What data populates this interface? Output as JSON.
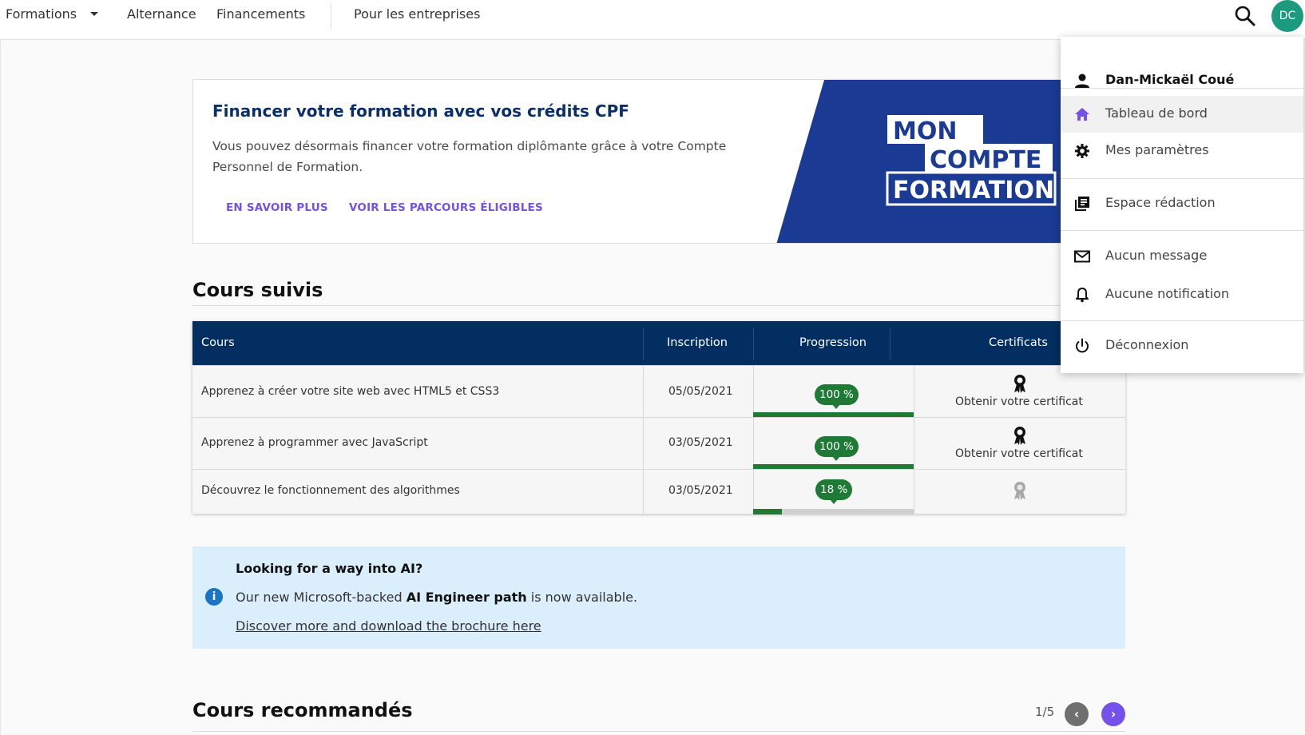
{
  "nav": {
    "items": [
      "Formations",
      "Alternance",
      "Financements",
      "Pour les entreprises"
    ],
    "avatar_initials": "DC",
    "icons": {
      "search": "search-icon",
      "formations_caret": "caret-down-icon"
    }
  },
  "cpf_banner": {
    "title": "Financer votre formation avec vos crédits CPF",
    "text": "Vous pouvez désormais financer votre formation diplômante grâce à votre Compte Personnel de Formation.",
    "link_more": "EN SAVOIR PLUS",
    "link_paths": "VOIR LES PARCOURS ÉLIGIBLES",
    "logo_lines": [
      "MON",
      "COMPTE",
      "FORMATION"
    ],
    "colors": {
      "title": "#0b2f6b",
      "links": "#7451eb",
      "logo_bg": "#1a3a94"
    }
  },
  "followed": {
    "title": "Cours suivis",
    "columns": [
      "Cours",
      "Inscription",
      "Progression",
      "Certificats"
    ],
    "rows": [
      {
        "course": "Apprenez à créer votre site web avec HTML5 et CSS3",
        "date": "05/05/2021",
        "progress_label": "100 %",
        "progress": 1.0,
        "certificate": "Obtenir votre certificat",
        "cert_state": "earned"
      },
      {
        "course": "Apprenez à programmer avec JavaScript",
        "date": "03/05/2021",
        "progress_label": "100 %",
        "progress": 1.0,
        "certificate": "Obtenir votre certificat",
        "cert_state": "earned"
      },
      {
        "course": "Découvrez le fonctionnement des algorithmes",
        "date": "03/05/2021",
        "progress_label": "18 %",
        "progress": 0.18,
        "certificate": "",
        "cert_state": "locked"
      }
    ],
    "colors": {
      "header": "#032e61",
      "progress": "#1f7a36"
    }
  },
  "info_banner": {
    "title": "Looking for a way into AI?",
    "text_before": "Our new Microsoft-backed ",
    "text_bold": "AI Engineer path",
    "text_after": " is now available.",
    "link": "Discover more and download the brochure here",
    "icon": "info-icon"
  },
  "recommended": {
    "title": "Cours recommandés",
    "pager": "1/5"
  },
  "user_menu": {
    "user_name": "Dan-Mickaël Coué",
    "items": [
      {
        "label": "Tableau de bord",
        "icon": "home-icon"
      },
      {
        "label": "Mes paramètres",
        "icon": "gear-icon"
      },
      {
        "label": "Espace rédaction",
        "icon": "library-icon"
      },
      {
        "label": "Aucun message",
        "icon": "mail-icon"
      },
      {
        "label": "Aucune notification",
        "icon": "bell-icon"
      },
      {
        "label": "Déconnexion",
        "icon": "power-icon"
      }
    ]
  }
}
